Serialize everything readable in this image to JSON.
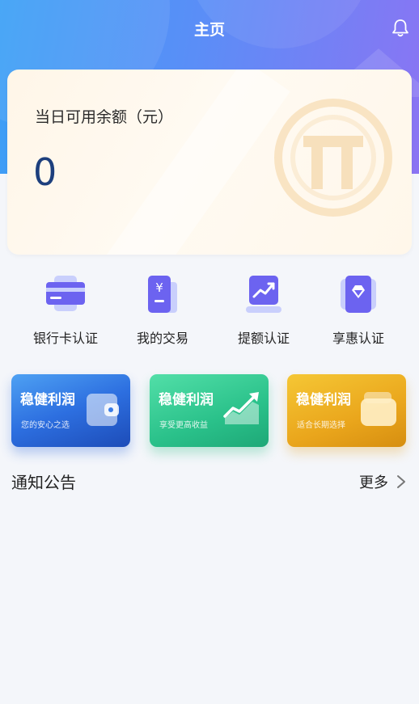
{
  "header": {
    "title": "主页",
    "bell_icon": "bell-icon"
  },
  "balance": {
    "label": "当日可用余额（元）",
    "value": "0",
    "watermark_icon": "logo-t-icon"
  },
  "quick_actions": [
    {
      "label": "银行卡认证",
      "icon": "bank-card-icon"
    },
    {
      "label": "我的交易",
      "icon": "transaction-icon"
    },
    {
      "label": "提额认证",
      "icon": "trend-up-icon"
    },
    {
      "label": "享惠认证",
      "icon": "diamond-icon"
    }
  ],
  "products": [
    {
      "title": "稳健利润",
      "subtitle": "您的安心之选",
      "icon": "wallet-icon",
      "color": "#2d6fe0"
    },
    {
      "title": "稳健利润",
      "subtitle": "享受更高收益",
      "icon": "chart-icon",
      "color": "#2ac18a"
    },
    {
      "title": "稳健利润",
      "subtitle": "适合长期选择",
      "icon": "purse-icon",
      "color": "#eaa61c"
    }
  ],
  "notice": {
    "title": "通知公告",
    "more_label": "更多"
  },
  "colors": {
    "primary": "#5a8ef7",
    "icon_purple": "#6c63f0",
    "balance_text": "#1d3f7d"
  }
}
